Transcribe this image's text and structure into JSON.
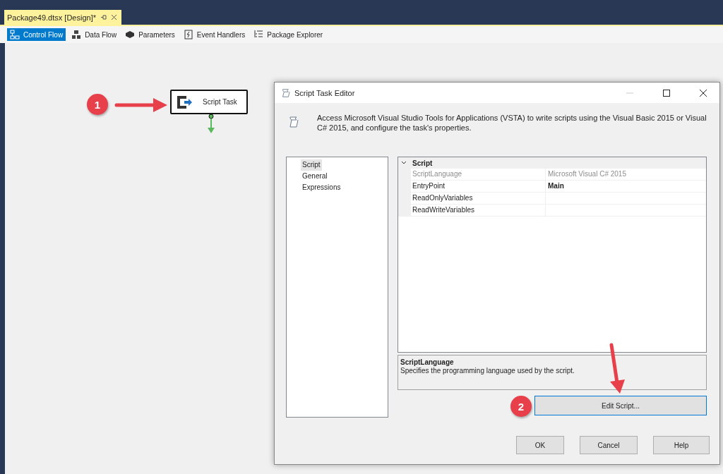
{
  "document_tab": {
    "title": "Package49.dtsx [Design]*"
  },
  "designer_tabs": [
    {
      "label": "Control Flow",
      "selected": true,
      "kind": "flow"
    },
    {
      "label": "Data Flow",
      "selected": false,
      "kind": "data"
    },
    {
      "label": "Parameters",
      "selected": false,
      "kind": "params"
    },
    {
      "label": "Event Handlers",
      "selected": false,
      "kind": "events"
    },
    {
      "label": "Package Explorer",
      "selected": false,
      "kind": "explorer"
    }
  ],
  "canvas": {
    "task": {
      "label": "Script Task"
    },
    "callouts": [
      "1",
      "2"
    ]
  },
  "dialog": {
    "title": "Script Task Editor",
    "description": "Access Microsoft Visual Studio Tools for Applications (VSTA) to write scripts using the Visual Basic 2015 or Visual C# 2015, and configure the task's properties.",
    "pages": [
      {
        "label": "Script",
        "selected": true
      },
      {
        "label": "General",
        "selected": false
      },
      {
        "label": "Expressions",
        "selected": false
      }
    ],
    "property_grid": {
      "category": "Script",
      "expanded": true,
      "properties": [
        {
          "name": "ScriptLanguage",
          "value": "Microsoft Visual C# 2015",
          "disabled": true,
          "modified": false
        },
        {
          "name": "EntryPoint",
          "value": "Main",
          "disabled": false,
          "modified": true
        },
        {
          "name": "ReadOnlyVariables",
          "disabled": false
        },
        {
          "name": "ReadWriteVariables",
          "disabled": false
        }
      ]
    },
    "help": {
      "title": "ScriptLanguage",
      "text": "Specifies the programming language used by the script."
    },
    "edit_button": "Edit Script...",
    "buttons": [
      "OK",
      "Cancel",
      "Help"
    ]
  }
}
